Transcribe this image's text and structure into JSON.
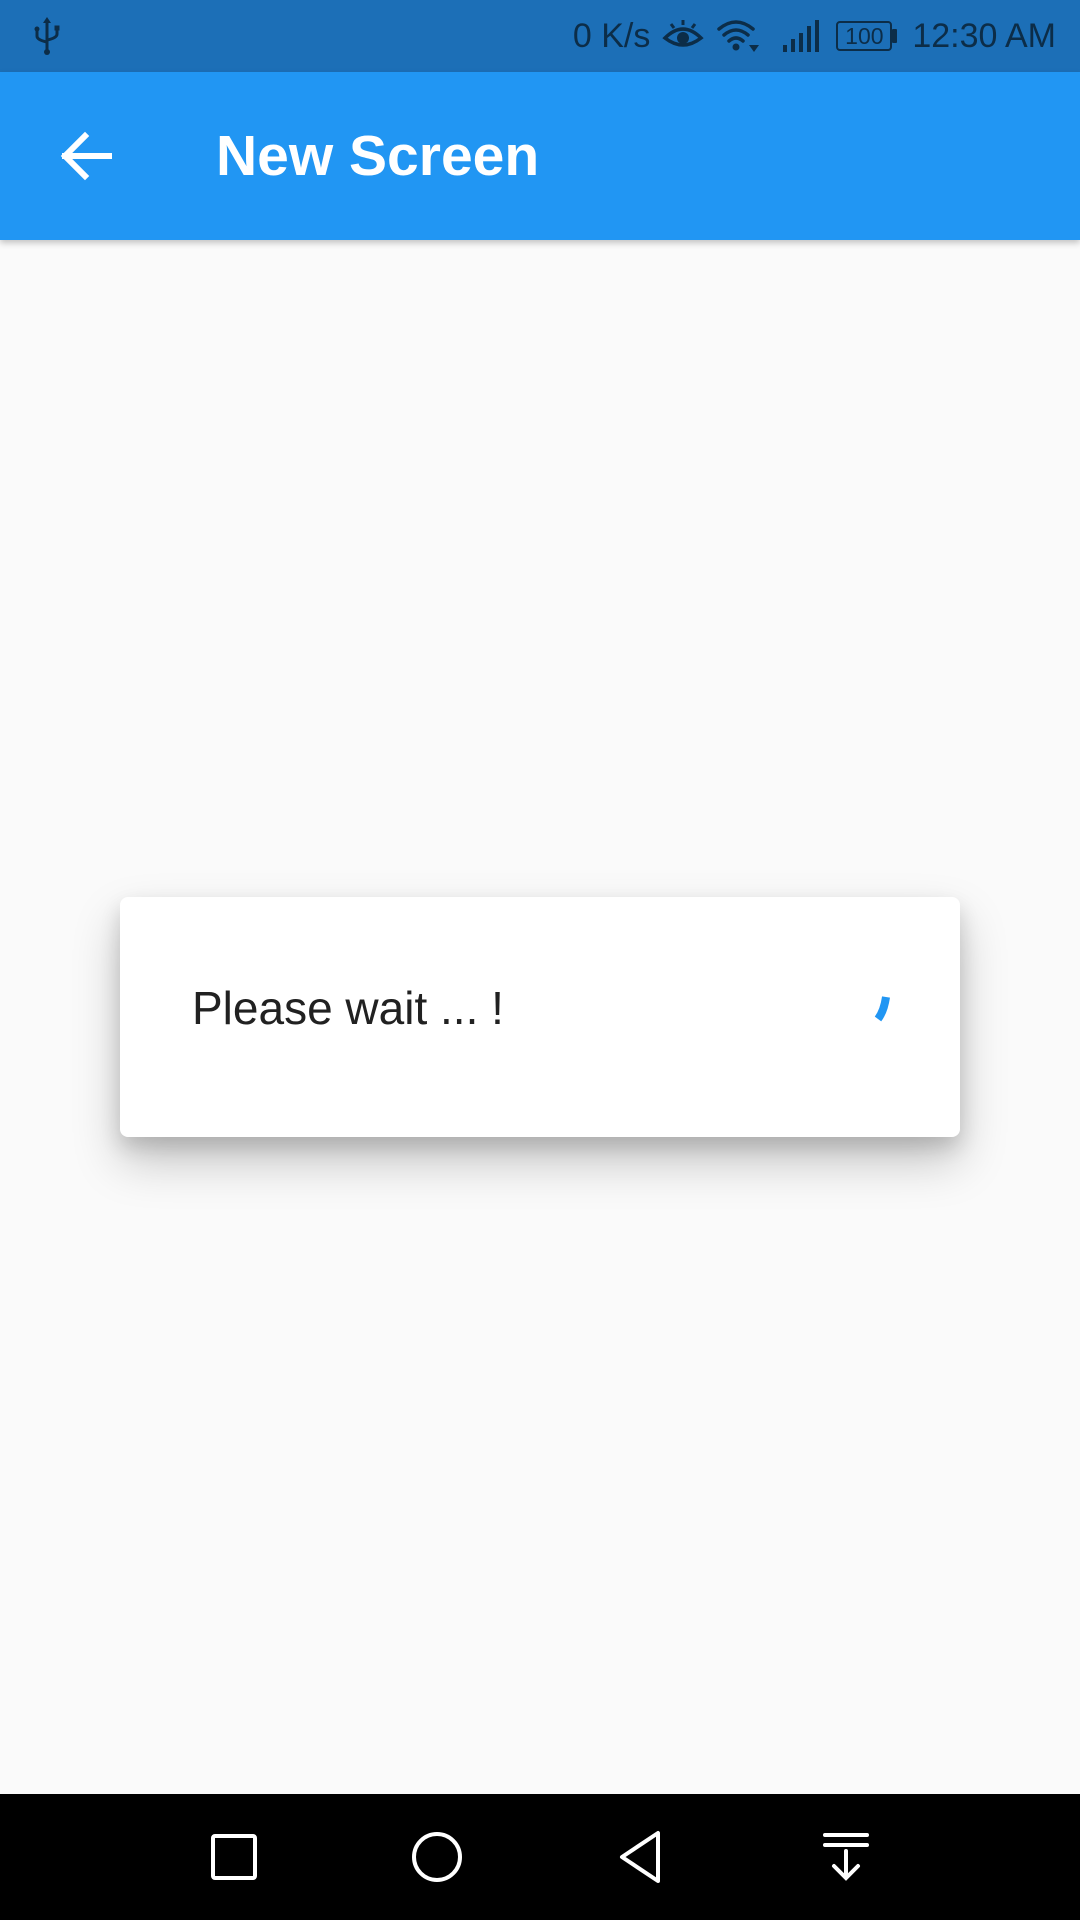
{
  "status_bar": {
    "network_speed": "0 K/s",
    "battery_level": "100",
    "time": "12:30 AM",
    "icons": [
      "usb-icon",
      "eye-comfort-icon",
      "wifi-icon",
      "signal-icon",
      "battery-icon"
    ]
  },
  "app_bar": {
    "title": "New Screen",
    "back_icon": "arrow-back-icon"
  },
  "dialog": {
    "message": "Please wait ... !",
    "indicator": "loading-spinner"
  },
  "nav_bar": {
    "buttons": [
      "recent-apps-icon",
      "home-icon",
      "back-icon",
      "notification-pull-down-icon"
    ]
  },
  "colors": {
    "status_bar": "#1c6fb7",
    "app_bar": "#2196f3",
    "background": "#fafafa",
    "dialog": "#ffffff",
    "spinner": "#2196f3",
    "nav_bar": "#000000"
  }
}
